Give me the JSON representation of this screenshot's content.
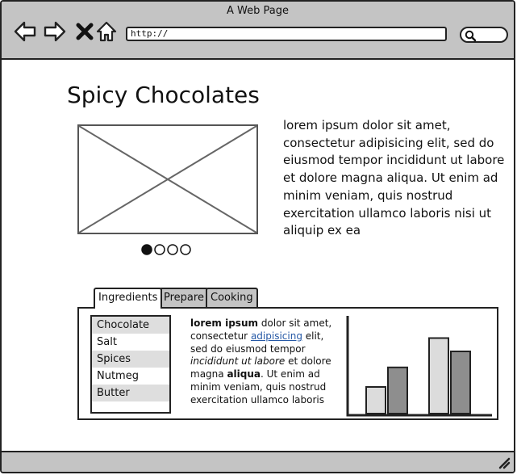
{
  "window": {
    "title": "A Web Page",
    "url": "http://"
  },
  "icons": [
    "back-arrow-icon",
    "forward-arrow-icon",
    "close-x-icon",
    "home-icon",
    "search-icon",
    "resize-grip-icon"
  ],
  "page": {
    "heading": "Spicy Chocolates",
    "carousel": {
      "slide_count": 4,
      "active_index": 0
    },
    "intro_text": "lorem ipsum dolor sit amet, consectetur adipisicing elit, sed do eiusmod tempor incididunt ut labore et dolore magna aliqua. Ut enim ad minim veniam, quis nostrud exercitation ullamco laboris nisi ut aliquip ex ea"
  },
  "tabs": [
    {
      "label": "Ingredients",
      "selected": true
    },
    {
      "label": "Prepare",
      "selected": false
    },
    {
      "label": "Cooking",
      "selected": false
    }
  ],
  "ingredients": [
    "Chocolate",
    "Salt",
    "Spices",
    "Nutmeg",
    "Butter"
  ],
  "panel_text": {
    "bold1": "lorem ipsum",
    "t1": " dolor sit amet, consectetur ",
    "link": "adipisicing",
    "t2": " elit, sed do eiusmod tempor ",
    "italic": "incididunt ut labore",
    "t3": " et dolore magna ",
    "bold2": "aliqua",
    "t4": ". Ut enim ad minim veniam, quis nostrud exercitation ullamco laboris nisi ut aliquip"
  },
  "colors": {
    "chrome": "#c4c4c4",
    "light_bar": "#dcdcdc",
    "dark_bar": "#8e8e8e",
    "link": "#2659a6"
  },
  "chart_data": {
    "type": "bar",
    "categories": [
      "",
      ""
    ],
    "series": [
      {
        "values": [
          3,
          5.2
        ]
      },
      {
        "values": [
          8.5,
          7
        ]
      }
    ],
    "ylim": [
      0,
      10
    ]
  }
}
